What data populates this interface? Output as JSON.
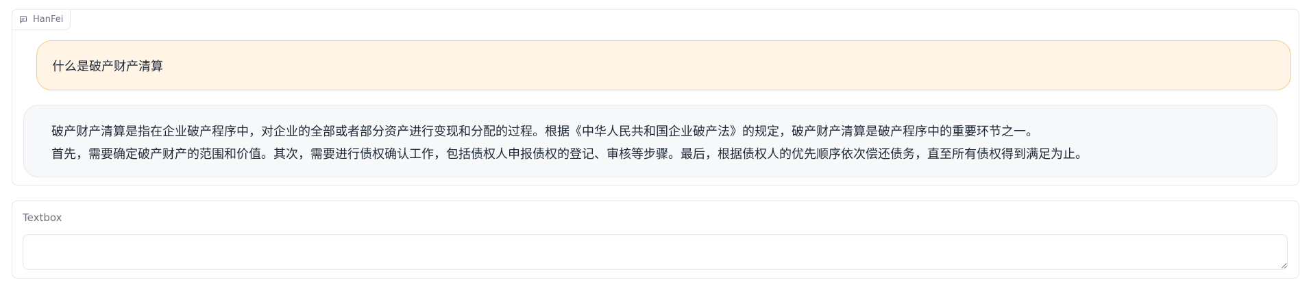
{
  "chatbot": {
    "label": "HanFei",
    "label_icon": "chat-icon",
    "messages": [
      {
        "role": "user",
        "text": "什么是破产财产清算"
      },
      {
        "role": "bot",
        "lines": [
          "破产财产清算是指在企业破产程序中，对企业的全部或者部分资产进行变现和分配的过程。根据《中华人民共和国企业破产法》的规定，破产财产清算是破产程序中的重要环节之一。",
          "首先，需要确定破产财产的范围和价值。其次，需要进行债权确认工作，包括债权人申报债权的登记、审核等步骤。最后，根据债权人的优先顺序依次偿还债务，直至所有债权得到满足为止。"
        ]
      }
    ]
  },
  "textbox": {
    "label": "Textbox",
    "value": "",
    "placeholder": ""
  },
  "colors": {
    "user_bubble_bg": "#fff4e6",
    "user_bubble_border": "#fbc97a",
    "bot_bubble_bg": "#f7f8fa",
    "border": "#e5e7eb"
  }
}
